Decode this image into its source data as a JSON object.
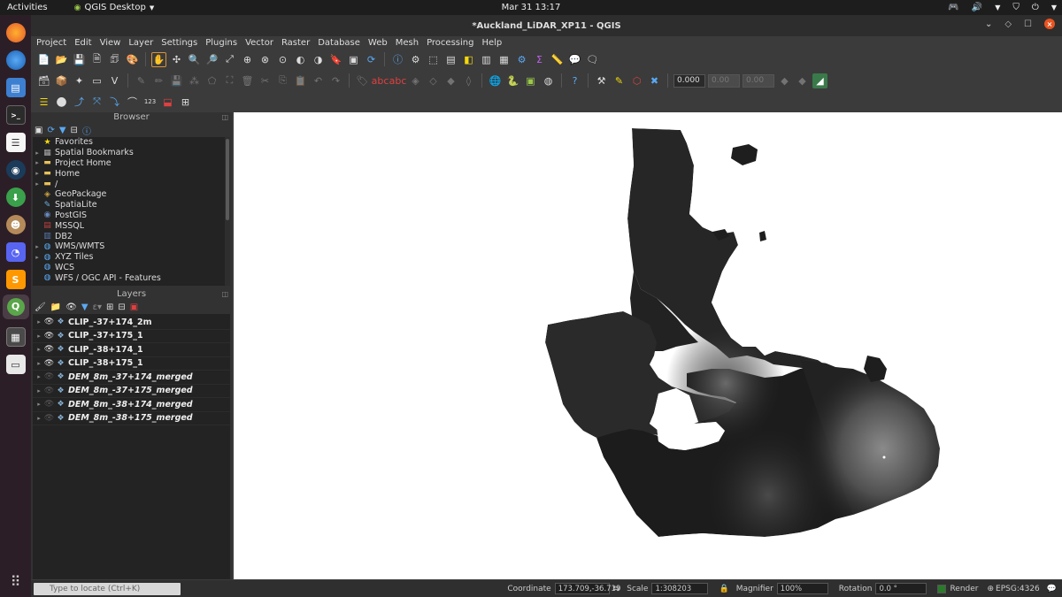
{
  "system": {
    "activities": "Activities",
    "app_name": "QGIS Desktop",
    "clock": "Mar 31  13:17"
  },
  "window": {
    "title": "*Auckland_LiDAR_XP11 - QGIS"
  },
  "menu": [
    "Project",
    "Edit",
    "View",
    "Layer",
    "Settings",
    "Plugins",
    "Vector",
    "Raster",
    "Database",
    "Web",
    "Mesh",
    "Processing",
    "Help"
  ],
  "digitizing": {
    "value_1": "0.000",
    "value_2": "0.00",
    "value_3": "0.00"
  },
  "browser": {
    "title": "Browser",
    "items": [
      {
        "label": "Favorites",
        "icon": "star-icon",
        "expand": false
      },
      {
        "label": "Spatial Bookmarks",
        "icon": "bookmark-icon",
        "expand": true
      },
      {
        "label": "Project Home",
        "icon": "folder-icon",
        "expand": true
      },
      {
        "label": "Home",
        "icon": "folder-icon",
        "expand": true
      },
      {
        "label": "/",
        "icon": "folder-icon",
        "expand": true
      },
      {
        "label": "GeoPackage",
        "icon": "geopackage-icon",
        "expand": false
      },
      {
        "label": "SpatiaLite",
        "icon": "spatialite-icon",
        "expand": false
      },
      {
        "label": "PostGIS",
        "icon": "postgis-icon",
        "expand": false
      },
      {
        "label": "MSSQL",
        "icon": "mssql-icon",
        "expand": false
      },
      {
        "label": "DB2",
        "icon": "db2-icon",
        "expand": false
      },
      {
        "label": "WMS/WMTS",
        "icon": "globe-icon",
        "expand": true
      },
      {
        "label": "XYZ Tiles",
        "icon": "globe-icon",
        "expand": true
      },
      {
        "label": "WCS",
        "icon": "globe-icon",
        "expand": false
      },
      {
        "label": "WFS / OGC API - Features",
        "icon": "globe-icon",
        "expand": false
      }
    ]
  },
  "layers": {
    "title": "Layers",
    "items": [
      {
        "name": "CLIP_-37+174_2m",
        "visible": true,
        "italic": false
      },
      {
        "name": "CLIP_-37+175_1",
        "visible": true,
        "italic": false
      },
      {
        "name": "CLIP_-38+174_1",
        "visible": true,
        "italic": false
      },
      {
        "name": "CLIP_-38+175_1",
        "visible": true,
        "italic": false
      },
      {
        "name": "DEM_8m_-37+174_merged",
        "visible": false,
        "italic": true
      },
      {
        "name": "DEM_8m_-37+175_merged",
        "visible": false,
        "italic": true
      },
      {
        "name": "DEM_8m_-38+174_merged",
        "visible": false,
        "italic": true
      },
      {
        "name": "DEM_8m_-38+175_merged",
        "visible": false,
        "italic": true
      }
    ]
  },
  "status": {
    "locator_placeholder": "Type to locate (Ctrl+K)",
    "coordinate_label": "Coordinate",
    "coordinate_value": "173.709,-36.719",
    "scale_label": "Scale",
    "scale_value": "1:308203",
    "magnifier_label": "Magnifier",
    "magnifier_value": "100%",
    "rotation_label": "Rotation",
    "rotation_value": "0.0 °",
    "render_label": "Render",
    "crs": "EPSG:4326"
  }
}
